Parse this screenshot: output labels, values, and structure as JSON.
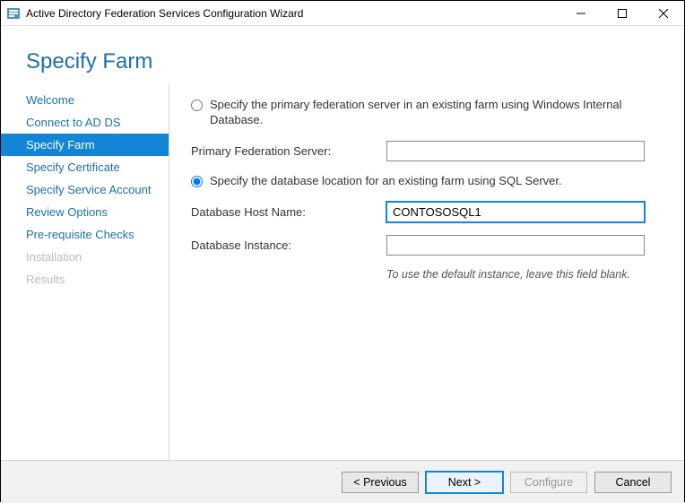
{
  "window": {
    "title": "Active Directory Federation Services Configuration Wizard"
  },
  "header": {
    "title": "Specify Farm"
  },
  "sidebar": {
    "items": [
      {
        "label": "Welcome",
        "state": "normal"
      },
      {
        "label": "Connect to AD DS",
        "state": "normal"
      },
      {
        "label": "Specify Farm",
        "state": "selected"
      },
      {
        "label": "Specify Certificate",
        "state": "normal"
      },
      {
        "label": "Specify Service Account",
        "state": "normal"
      },
      {
        "label": "Review Options",
        "state": "normal"
      },
      {
        "label": "Pre-requisite Checks",
        "state": "normal"
      },
      {
        "label": "Installation",
        "state": "disabled"
      },
      {
        "label": "Results",
        "state": "disabled"
      }
    ]
  },
  "content": {
    "option_wid": {
      "label": "Specify the primary federation server in an existing farm using Windows Internal Database.",
      "checked": false
    },
    "primary_server": {
      "label": "Primary Federation Server:",
      "value": ""
    },
    "option_sql": {
      "label": "Specify the database location for an existing farm using SQL Server.",
      "checked": true
    },
    "db_host": {
      "label": "Database Host Name:",
      "value": "CONTOSOSQL1"
    },
    "db_instance": {
      "label": "Database Instance:",
      "value": ""
    },
    "hint": "To use the default instance, leave this field blank."
  },
  "footer": {
    "previous": "< Previous",
    "next": "Next >",
    "configure": "Configure",
    "cancel": "Cancel"
  }
}
